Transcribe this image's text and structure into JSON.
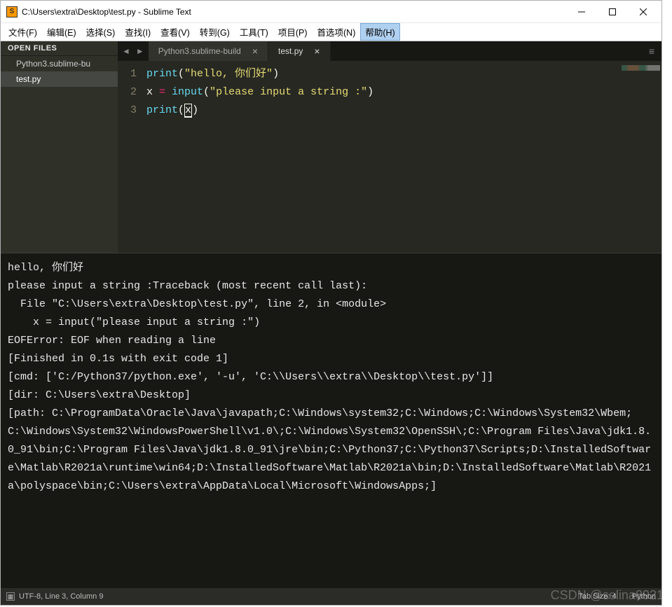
{
  "window": {
    "title": "C:\\Users\\extra\\Desktop\\test.py - Sublime Text"
  },
  "menubar": [
    "文件(F)",
    "编辑(E)",
    "选择(S)",
    "查找(I)",
    "查看(V)",
    "转到(G)",
    "工具(T)",
    "项目(P)",
    "首选项(N)",
    "帮助(H)"
  ],
  "sidebar": {
    "header": "OPEN FILES",
    "files": [
      {
        "name": "Python3.sublime-bu",
        "active": false
      },
      {
        "name": "test.py",
        "active": true
      }
    ]
  },
  "tabs": [
    {
      "label": "Python3.sublime-build",
      "active": false
    },
    {
      "label": "test.py",
      "active": true
    }
  ],
  "editor": {
    "lines": [
      "1",
      "2",
      "3"
    ],
    "code": {
      "l1_print": "print",
      "l1_open": "(",
      "l1_str": "\"hello, 你们好\"",
      "l1_close": ")",
      "l2_x": "x ",
      "l2_eq": "= ",
      "l2_input": "input",
      "l2_open": "(",
      "l2_str": "\"please input a string :\"",
      "l2_close": ")",
      "l3_print": "print",
      "l3_open": "(",
      "l3_x": "x",
      "l3_close": ")"
    }
  },
  "console": "hello, 你们好\nplease input a string :Traceback (most recent call last):\n  File \"C:\\Users\\extra\\Desktop\\test.py\", line 2, in <module>\n    x = input(\"please input a string :\")\nEOFError: EOF when reading a line\n[Finished in 0.1s with exit code 1]\n[cmd: ['C:/Python37/python.exe', '-u', 'C:\\\\Users\\\\extra\\\\Desktop\\\\test.py']]\n[dir: C:\\Users\\extra\\Desktop]\n[path: C:\\ProgramData\\Oracle\\Java\\javapath;C:\\Windows\\system32;C:\\Windows;C:\\Windows\\System32\\Wbem;C:\\Windows\\System32\\WindowsPowerShell\\v1.0\\;C:\\Windows\\System32\\OpenSSH\\;C:\\Program Files\\Java\\jdk1.8.0_91\\bin;C:\\Program Files\\Java\\jdk1.8.0_91\\jre\\bin;C:\\Python37;C:\\Python37\\Scripts;D:\\InstalledSoftware\\Matlab\\R2021a\\runtime\\win64;D:\\InstalledSoftware\\Matlab\\R2021a\\bin;D:\\InstalledSoftware\\Matlab\\R2021a\\polyspace\\bin;C:\\Users\\extra\\AppData\\Local\\Microsoft\\WindowsApps;]",
  "statusbar": {
    "left": "UTF-8, Line 3, Column 9",
    "tabsize": "Tab Size: 4",
    "lang": "Python"
  },
  "watermark": "CSDN @selina8921"
}
